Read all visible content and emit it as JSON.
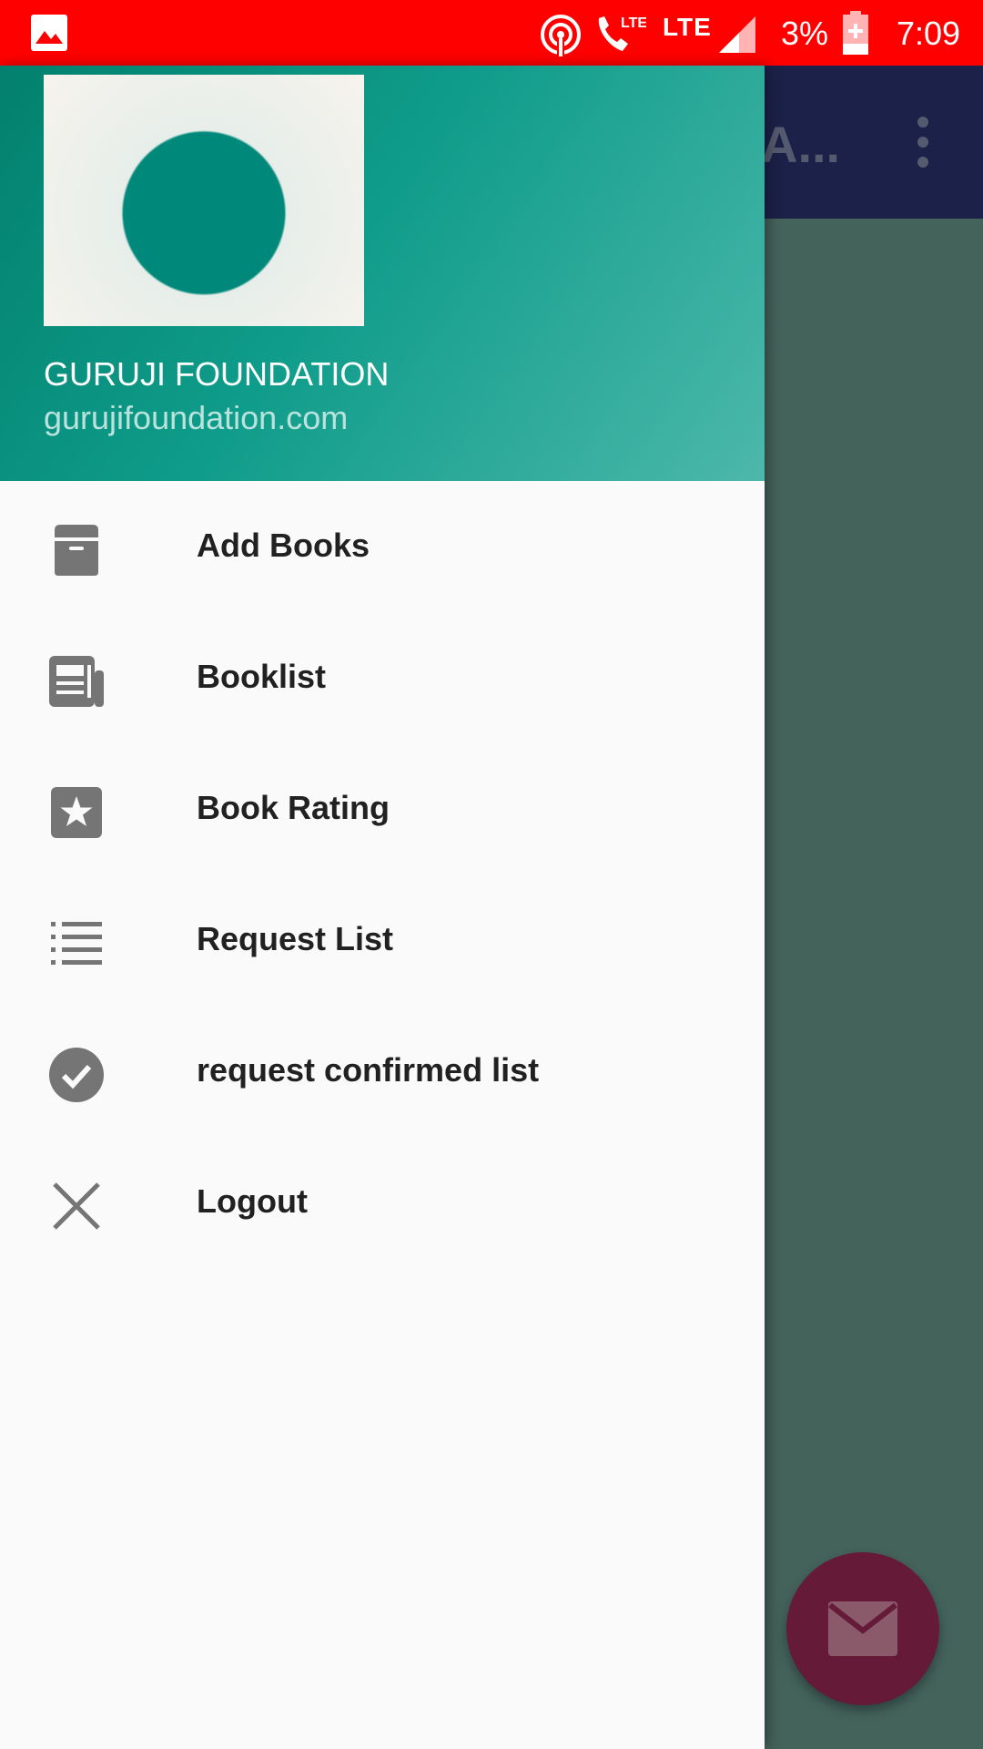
{
  "status_bar": {
    "lte_label": "LTE",
    "battery_percent": "3%",
    "time": "7:09"
  },
  "app_bar": {
    "title_fragment": "A..."
  },
  "drawer": {
    "header": {
      "name": "GURUJI FOUNDATION",
      "website": "gurujifoundation.com"
    },
    "items": [
      {
        "label": "Add Books",
        "icon": "archive-icon"
      },
      {
        "label": "Booklist",
        "icon": "newspaper-icon"
      },
      {
        "label": "Book Rating",
        "icon": "star-box-icon"
      },
      {
        "label": "Request List",
        "icon": "list-icon"
      },
      {
        "label": "request confirmed list",
        "icon": "check-circle-icon"
      },
      {
        "label": "Logout",
        "icon": "close-icon"
      }
    ]
  },
  "fab": {
    "icon": "mail-icon"
  },
  "colors": {
    "status_bar": "#ff0000",
    "header_start": "#03806e",
    "header_end": "#4cb8ab",
    "icon_gray": "#757575"
  }
}
